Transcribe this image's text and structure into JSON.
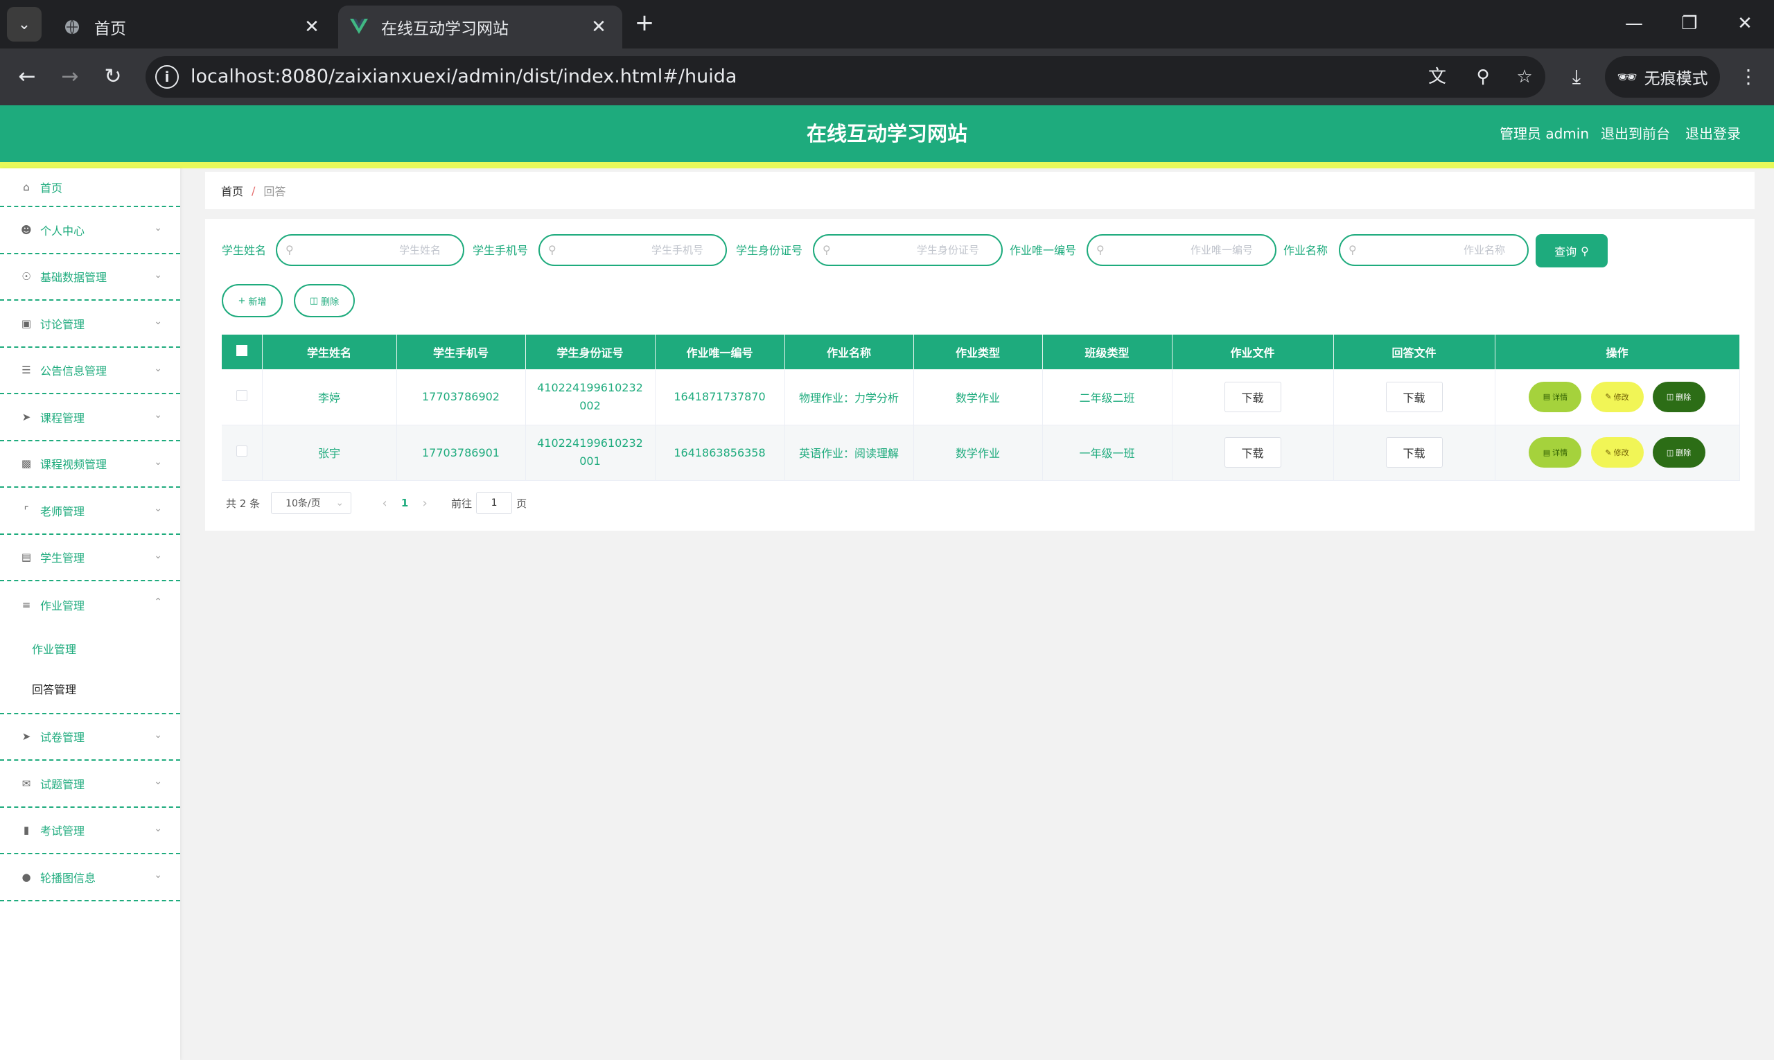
{
  "browser": {
    "tabs": [
      {
        "title": "首页",
        "icon": "globe-icon",
        "active": false
      },
      {
        "title": "在线互动学习网站",
        "icon": "vue-logo-icon",
        "active": true
      }
    ],
    "url": "localhost:8080/zaixianxuexi/admin/dist/index.html#/huida",
    "incognito_label": "无痕模式"
  },
  "app": {
    "title": "在线互动学习网站",
    "user_label": "管理员 admin",
    "front_link": "退出到前台",
    "logout_link": "退出登录",
    "brand_color": "#1eab7d",
    "accent_color": "#e7f95a"
  },
  "sidebar": {
    "items": [
      {
        "label": "首页",
        "icon": "home-icon"
      },
      {
        "label": "个人中心",
        "icon": "user-icon"
      },
      {
        "label": "基础数据管理",
        "icon": "compass-icon"
      },
      {
        "label": "讨论管理",
        "icon": "chat-icon"
      },
      {
        "label": "公告信息管理",
        "icon": "list-icon"
      },
      {
        "label": "课程管理",
        "icon": "send-icon"
      },
      {
        "label": "课程视频管理",
        "icon": "monitor-icon"
      },
      {
        "label": "老师管理",
        "icon": "crop-icon"
      },
      {
        "label": "学生管理",
        "icon": "clipboard-icon"
      },
      {
        "label": "作业管理",
        "icon": "sliders-icon",
        "expanded": true,
        "children": [
          "作业管理",
          "回答管理"
        ]
      },
      {
        "label": "试卷管理",
        "icon": "paper-plane-icon"
      },
      {
        "label": "试题管理",
        "icon": "mail-icon"
      },
      {
        "label": "考试管理",
        "icon": "ticket-icon"
      },
      {
        "label": "轮播图信息",
        "icon": "pin-icon"
      }
    ]
  },
  "breadcrumb": {
    "home": "首页",
    "separator": "/",
    "current": "回答"
  },
  "search": {
    "fields": [
      {
        "label": "学生姓名",
        "placeholder": "学生姓名"
      },
      {
        "label": "学生手机号",
        "placeholder": "学生手机号"
      },
      {
        "label": "学生身份证号",
        "placeholder": "学生身份证号"
      },
      {
        "label": "作业唯一编号",
        "placeholder": "作业唯一编号"
      },
      {
        "label": "作业名称",
        "placeholder": "作业名称"
      }
    ],
    "query_label": "查询"
  },
  "actions": {
    "add_label": "新增",
    "delete_label": "删除"
  },
  "table": {
    "columns": [
      "学生姓名",
      "学生手机号",
      "学生身份证号",
      "作业唯一编号",
      "作业名称",
      "作业类型",
      "班级类型",
      "作业文件",
      "回答文件",
      "操作"
    ],
    "download_label": "下载",
    "detail_label": "详情",
    "edit_label": "修改",
    "delete_label": "删除",
    "rows": [
      {
        "name": "李婷",
        "phone": "17703786902",
        "id_card": "410224199610232002",
        "hw_no": "1641871737870",
        "hw_name": "物理作业：力学分析",
        "hw_type": "数学作业",
        "class_type": "二年级二班"
      },
      {
        "name": "张宇",
        "phone": "17703786901",
        "id_card": "410224199610232001",
        "hw_no": "1641863856358",
        "hw_name": "英语作业：阅读理解",
        "hw_type": "数学作业",
        "class_type": "一年级一班"
      }
    ]
  },
  "pagination": {
    "total": "共 2 条",
    "page_size": "10条/页",
    "current_page": "1",
    "goto_label": "前往",
    "goto_value": "1",
    "page_suffix": "页"
  }
}
